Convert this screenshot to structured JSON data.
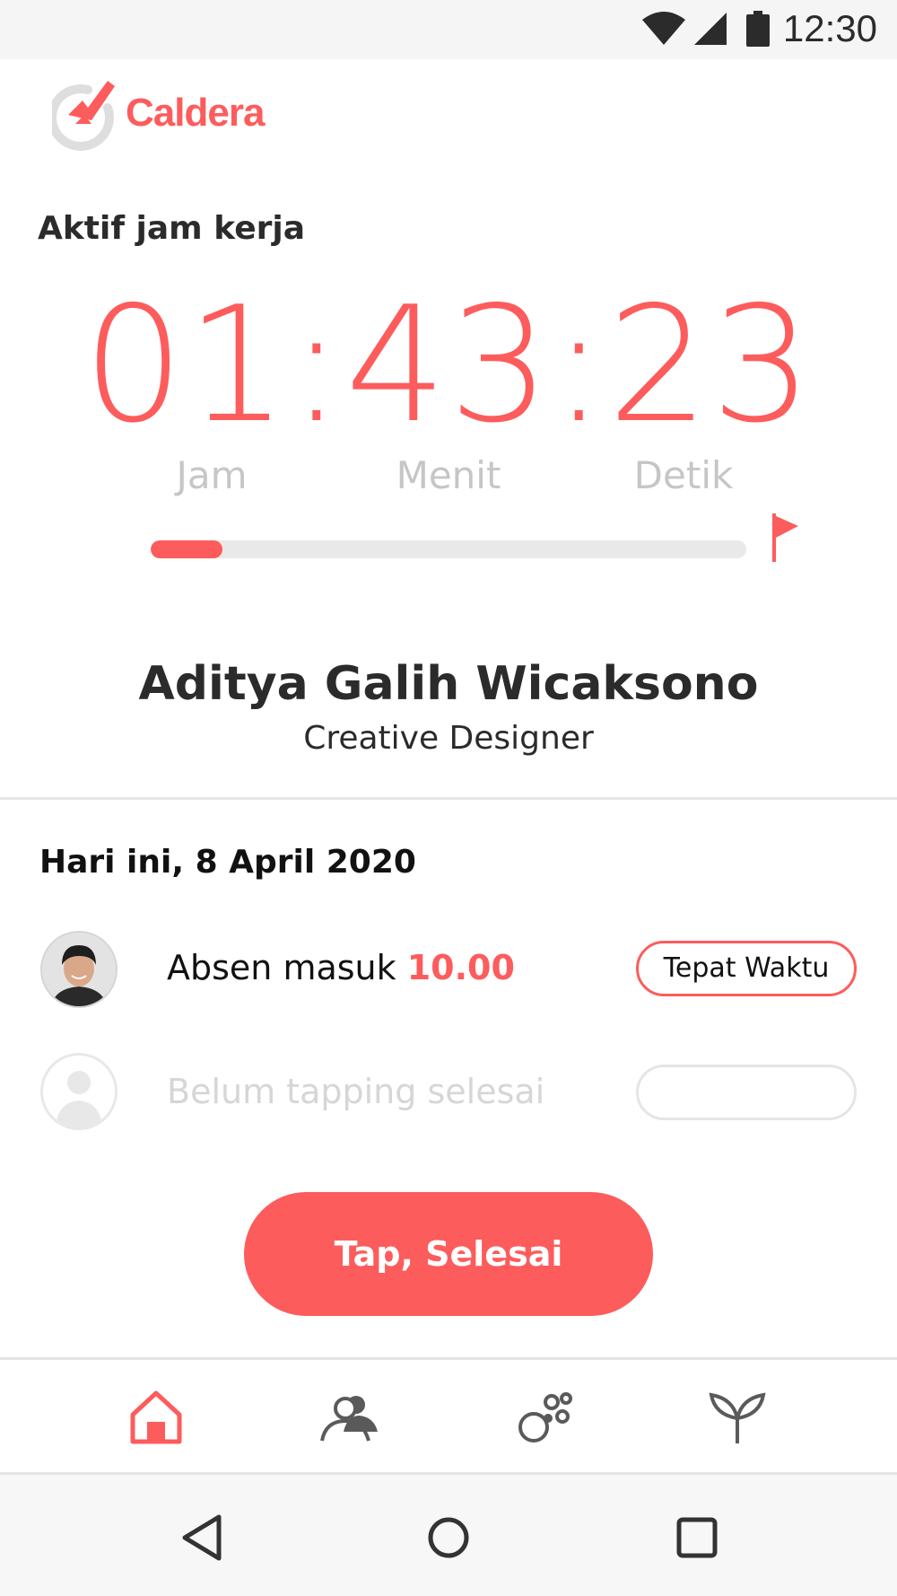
{
  "status_bar": {
    "time": "12:30"
  },
  "app": {
    "name": "Caldera"
  },
  "work": {
    "section_label": "Aktif jam kerja",
    "timer": "01:43:23",
    "units": {
      "hours": "Jam",
      "minutes": "Menit",
      "seconds": "Detik"
    },
    "progress_fraction": 0.12
  },
  "user": {
    "name": "Aditya Galih Wicaksono",
    "role": "Creative Designer"
  },
  "today": {
    "heading": "Hari ini, 8 April 2020",
    "checkin": {
      "label": "Absen masuk ",
      "time": "10.00",
      "status": "Tepat Waktu"
    },
    "checkout": {
      "label": "Belum tapping selesai",
      "status": ""
    }
  },
  "cta": {
    "label": "Tap, Selesai"
  },
  "bottom_nav": {
    "items": [
      {
        "icon": "home-icon",
        "active": true
      },
      {
        "icon": "team-icon",
        "active": false
      },
      {
        "icon": "bubbles-icon",
        "active": false
      },
      {
        "icon": "sprout-icon",
        "active": false
      }
    ]
  },
  "colors": {
    "accent": "#fd5c5c",
    "text": "#2b2b2b",
    "muted": "#c6c6c6",
    "icon": "#5a5a5a"
  }
}
